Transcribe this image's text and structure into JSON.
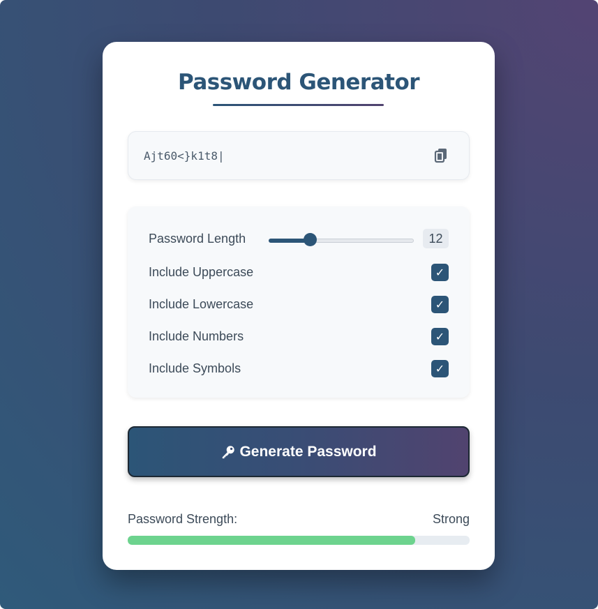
{
  "app": {
    "title": "Password Generator"
  },
  "password": {
    "value": "Ajt60<}k1t8|"
  },
  "options": {
    "length_label": "Password Length",
    "length_value": "12",
    "length_min": 4,
    "length_max": 32,
    "items": [
      {
        "label": "Include Uppercase",
        "checked": true
      },
      {
        "label": "Include Lowercase",
        "checked": true
      },
      {
        "label": "Include Numbers",
        "checked": true
      },
      {
        "label": "Include Symbols",
        "checked": true
      }
    ],
    "check_glyph": "✓"
  },
  "generate_button": {
    "label": "Generate Password",
    "icon": "key-icon"
  },
  "strength": {
    "label": "Password Strength:",
    "value": "Strong",
    "level": 0.84,
    "color": "#6dd38e"
  },
  "colors": {
    "primary": "#2c5577",
    "accent": "#51436f"
  },
  "icons": {
    "copy": "copy-icon"
  }
}
